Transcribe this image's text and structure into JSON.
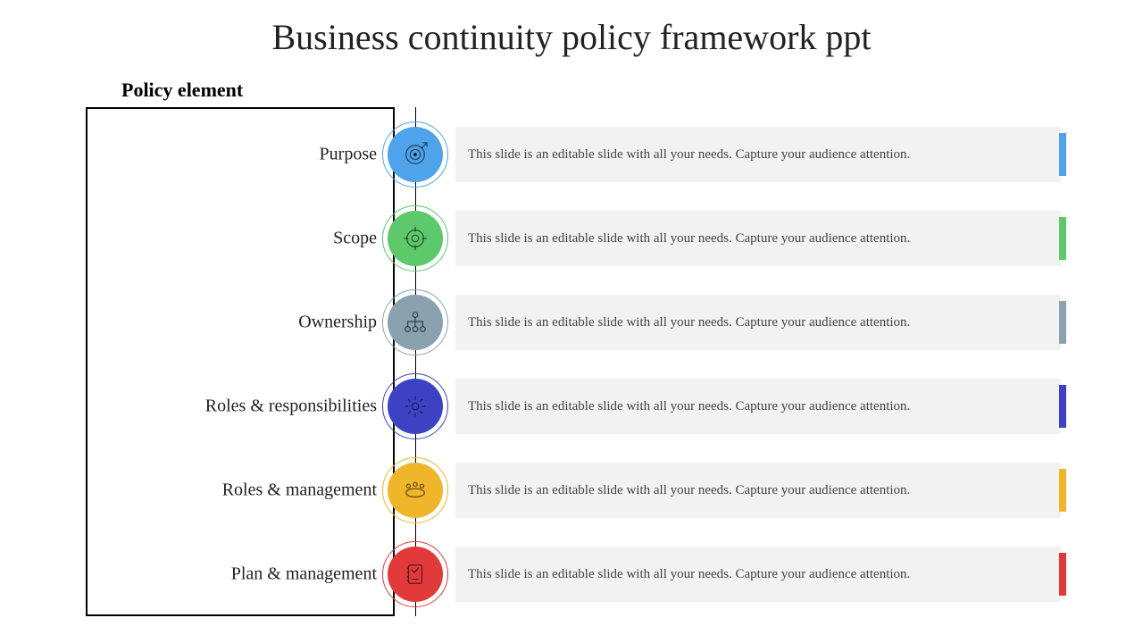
{
  "title": "Business continuity policy framework ppt",
  "subtitle": "Policy element",
  "rows": [
    {
      "label": "Purpose",
      "color": "#4ea3ea",
      "icon": "target-arrow-icon",
      "desc": "This slide is an editable slide with all your needs. Capture your audience attention."
    },
    {
      "label": "Scope",
      "color": "#5ec96a",
      "icon": "crosshair-icon",
      "desc": "This slide is an editable slide with all your needs. Capture your audience attention."
    },
    {
      "label": "Ownership",
      "color": "#8aa1af",
      "icon": "org-chart-icon",
      "desc": "This slide is an editable slide with all your needs. Capture your audience attention."
    },
    {
      "label": "Roles & responsibilities",
      "color": "#3d42c4",
      "icon": "gear-icon",
      "desc": "This slide is an editable slide with all your needs. Capture your audience attention."
    },
    {
      "label": "Roles & management",
      "color": "#f0b62b",
      "icon": "meeting-icon",
      "desc": "This slide is an editable slide with all your needs. Capture your audience attention."
    },
    {
      "label": "Plan & management",
      "color": "#e23a3a",
      "icon": "plan-book-icon",
      "desc": "This slide is an editable slide with all your needs. Capture your audience attention."
    }
  ]
}
